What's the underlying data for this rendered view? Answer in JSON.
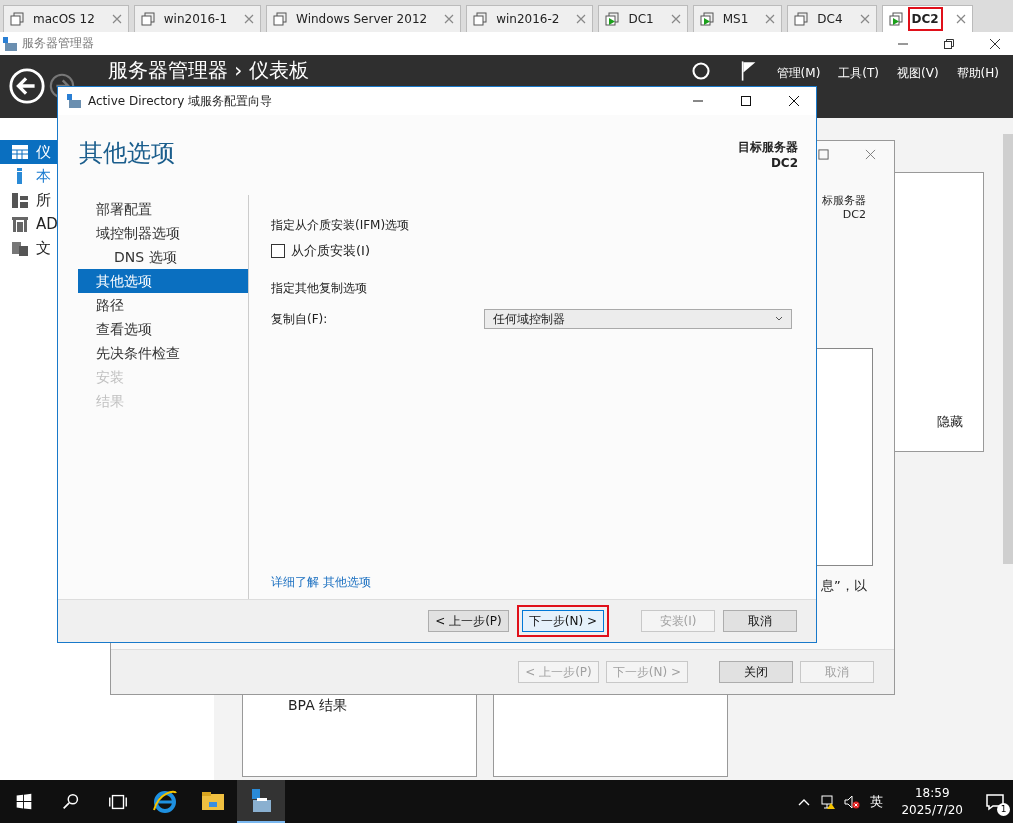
{
  "vm_tabs": [
    {
      "label": "macOS 12",
      "kind": "stopped",
      "selected": false,
      "highlighted": false
    },
    {
      "label": "win2016-1",
      "kind": "stopped",
      "selected": false,
      "highlighted": false
    },
    {
      "label": "Windows Server 2012",
      "kind": "stopped",
      "selected": false,
      "highlighted": false
    },
    {
      "label": "win2016-2",
      "kind": "stopped",
      "selected": false,
      "highlighted": false
    },
    {
      "label": "DC1",
      "kind": "running",
      "selected": false,
      "highlighted": false
    },
    {
      "label": "MS1",
      "kind": "running",
      "selected": false,
      "highlighted": false
    },
    {
      "label": "DC4",
      "kind": "stopped",
      "selected": false,
      "highlighted": false
    },
    {
      "label": "DC2",
      "kind": "running",
      "selected": true,
      "highlighted": true
    }
  ],
  "server_manager": {
    "title": "服务器管理器",
    "breadcrumb": "服务器管理器 › 仪表板",
    "menu": [
      "管理(M)",
      "工具(T)",
      "视图(V)",
      "帮助(H)"
    ],
    "sidebar": [
      {
        "label": "仪",
        "kind": "dashboard",
        "selected": true
      },
      {
        "label": "本",
        "kind": "local",
        "selected": false
      },
      {
        "label": "所",
        "kind": "all",
        "selected": false
      },
      {
        "label": "AD",
        "kind": "ad",
        "selected": false
      },
      {
        "label": "文",
        "kind": "files",
        "selected": false
      }
    ],
    "panel_link": "隐藏",
    "tile_title": "BPA 结果"
  },
  "back_dialog": {
    "target_label": "标服务器",
    "target_server": "DC2",
    "fragment": "息”，以",
    "buttons": [
      {
        "label": "< 上一步(P)",
        "disabled": true
      },
      {
        "label": "下一步(N) >",
        "disabled": true
      },
      {
        "label": "关闭",
        "disabled": false
      },
      {
        "label": "取消",
        "disabled": true
      }
    ]
  },
  "wizard": {
    "title": "Active Directory 域服务配置向导",
    "heading": "其他选项",
    "target_label": "目标服务器",
    "target_server": "DC2",
    "nav": [
      {
        "label": "部署配置",
        "selected": false,
        "disabled": false
      },
      {
        "label": "域控制器选项",
        "selected": false,
        "disabled": false,
        "children": [
          {
            "label": "DNS 选项",
            "selected": false,
            "disabled": false
          }
        ]
      },
      {
        "label": "其他选项",
        "selected": true,
        "disabled": false
      },
      {
        "label": "路径",
        "selected": false,
        "disabled": false
      },
      {
        "label": "查看选项",
        "selected": false,
        "disabled": false
      },
      {
        "label": "先决条件检查",
        "selected": false,
        "disabled": false
      },
      {
        "label": "安装",
        "selected": false,
        "disabled": true
      },
      {
        "label": "结果",
        "selected": false,
        "disabled": true
      }
    ],
    "ifm_heading": "指定从介质安装(IFM)选项",
    "ifm_checkbox": {
      "label": "从介质安装(I)",
      "checked": false
    },
    "replication_heading": "指定其他复制选项",
    "replicate_label": "复制自(F):",
    "replicate_value": "任何域控制器",
    "link": "详细了解 其他选项",
    "buttons": [
      {
        "label": "< 上一步(P)",
        "disabled": false,
        "highlighted": false
      },
      {
        "label": "下一步(N) >",
        "disabled": false,
        "highlighted": true
      },
      {
        "label": "安装(I)",
        "disabled": true,
        "highlighted": false
      },
      {
        "label": "取消",
        "disabled": false,
        "highlighted": false
      }
    ]
  },
  "taskbar": {
    "apps": [
      {
        "kind": "ie",
        "selected": false
      },
      {
        "kind": "explorer",
        "selected": false
      },
      {
        "kind": "server-manager",
        "selected": true
      }
    ],
    "ime": "英",
    "time": "18:59",
    "date": "2025/7/20",
    "notifications": "1"
  }
}
